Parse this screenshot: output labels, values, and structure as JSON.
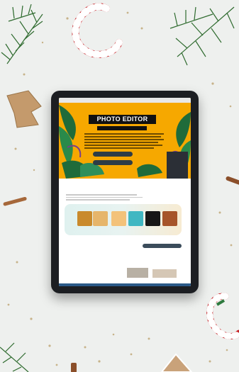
{
  "scene": {
    "background": "#eef0ee",
    "decorations": [
      "pine-branch",
      "candy-cane",
      "burlap-tree",
      "cinnamon-stick",
      "seeds"
    ]
  },
  "tablet": {
    "screen": {
      "hero": {
        "title": "PHOTO EDITOR",
        "subtitle": "",
        "accent_color": "#f6a800"
      },
      "section_heading": "",
      "footer_color": "#2b5a88"
    }
  }
}
